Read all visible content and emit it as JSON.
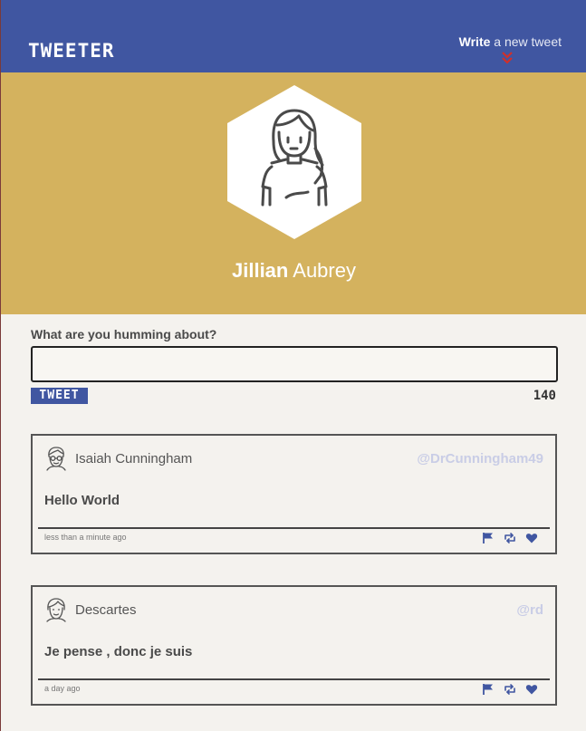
{
  "nav": {
    "brand": "TWEETER",
    "compose_strong": "Write",
    "compose_light": " a new tweet",
    "compose_icon": "double-chevron-down-icon"
  },
  "profile": {
    "first_name": "Jillian",
    "last_name": "Aubrey",
    "avatar_icon": "woman-avatar-icon"
  },
  "composer": {
    "label": "What are you humming about?",
    "value": "",
    "button_label": "TWEET",
    "counter": "140"
  },
  "tweets": [
    {
      "author": "Isaiah Cunningham",
      "handle": "@DrCunningham49",
      "body": "Hello World",
      "time": "less than a minute ago",
      "avatar_icon": "man-with-glasses-avatar-icon"
    },
    {
      "author": "Descartes",
      "handle": "@rd",
      "body": "Je pense , donc je suis",
      "time": "a day ago",
      "avatar_icon": "boy-avatar-icon"
    }
  ],
  "colors": {
    "nav_bg": "#4056a1",
    "profile_bg": "#d4b25e",
    "page_bg": "#f4f2ee",
    "chevron": "#d0302a",
    "handle": "#c9cde6"
  }
}
